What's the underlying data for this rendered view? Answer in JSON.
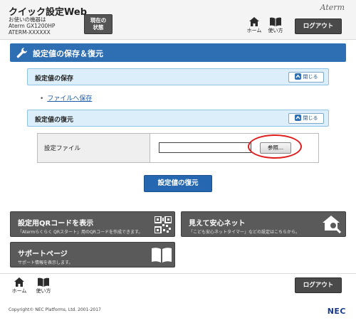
{
  "header": {
    "app_title": "クイック設定Web",
    "device_label": "お使いの機器は",
    "device_model": "Aterm GX1200HP",
    "device_id": "ATERM-XXXXXX",
    "status_button": "現在の\n状態",
    "brand": "Aterm",
    "home_label": "ホーム",
    "help_label": "使い方",
    "logout_label": "ログアウト"
  },
  "section": {
    "title": "設定値の保存＆復元"
  },
  "save_panel": {
    "title": "設定値の保存",
    "close_label": "閉じる",
    "link_label": "ファイルへ保存"
  },
  "restore_panel": {
    "title": "設定値の復元",
    "close_label": "閉じる",
    "file_label": "設定ファイル",
    "file_value": "",
    "browse_label": "参照...",
    "restore_button": "設定値の復元"
  },
  "tiles": [
    {
      "title": "設定用QRコードを表示",
      "desc": "「Atermらくらく QRスタート」用のQRコードを作成できます。",
      "icon": "qr-code-icon"
    },
    {
      "title": "見えて安心ネット",
      "desc": "「こども安心ネットタイマー」などの設定はこちらから。",
      "icon": "house-search-icon"
    },
    {
      "title": "サポートページ",
      "desc": "サポート情報を表示します。",
      "icon": "book-icon"
    }
  ],
  "footer": {
    "home_label": "ホーム",
    "help_label": "使い方",
    "logout_label": "ログアウト",
    "copyright": "Copyright© NEC Platforms, Ltd. 2001-2017",
    "logo": "NEC"
  },
  "colors": {
    "accent": "#2e6fb4",
    "panel_head": "#dbeefa",
    "tile": "#5a5a5a",
    "highlight": "#e01b1b"
  }
}
